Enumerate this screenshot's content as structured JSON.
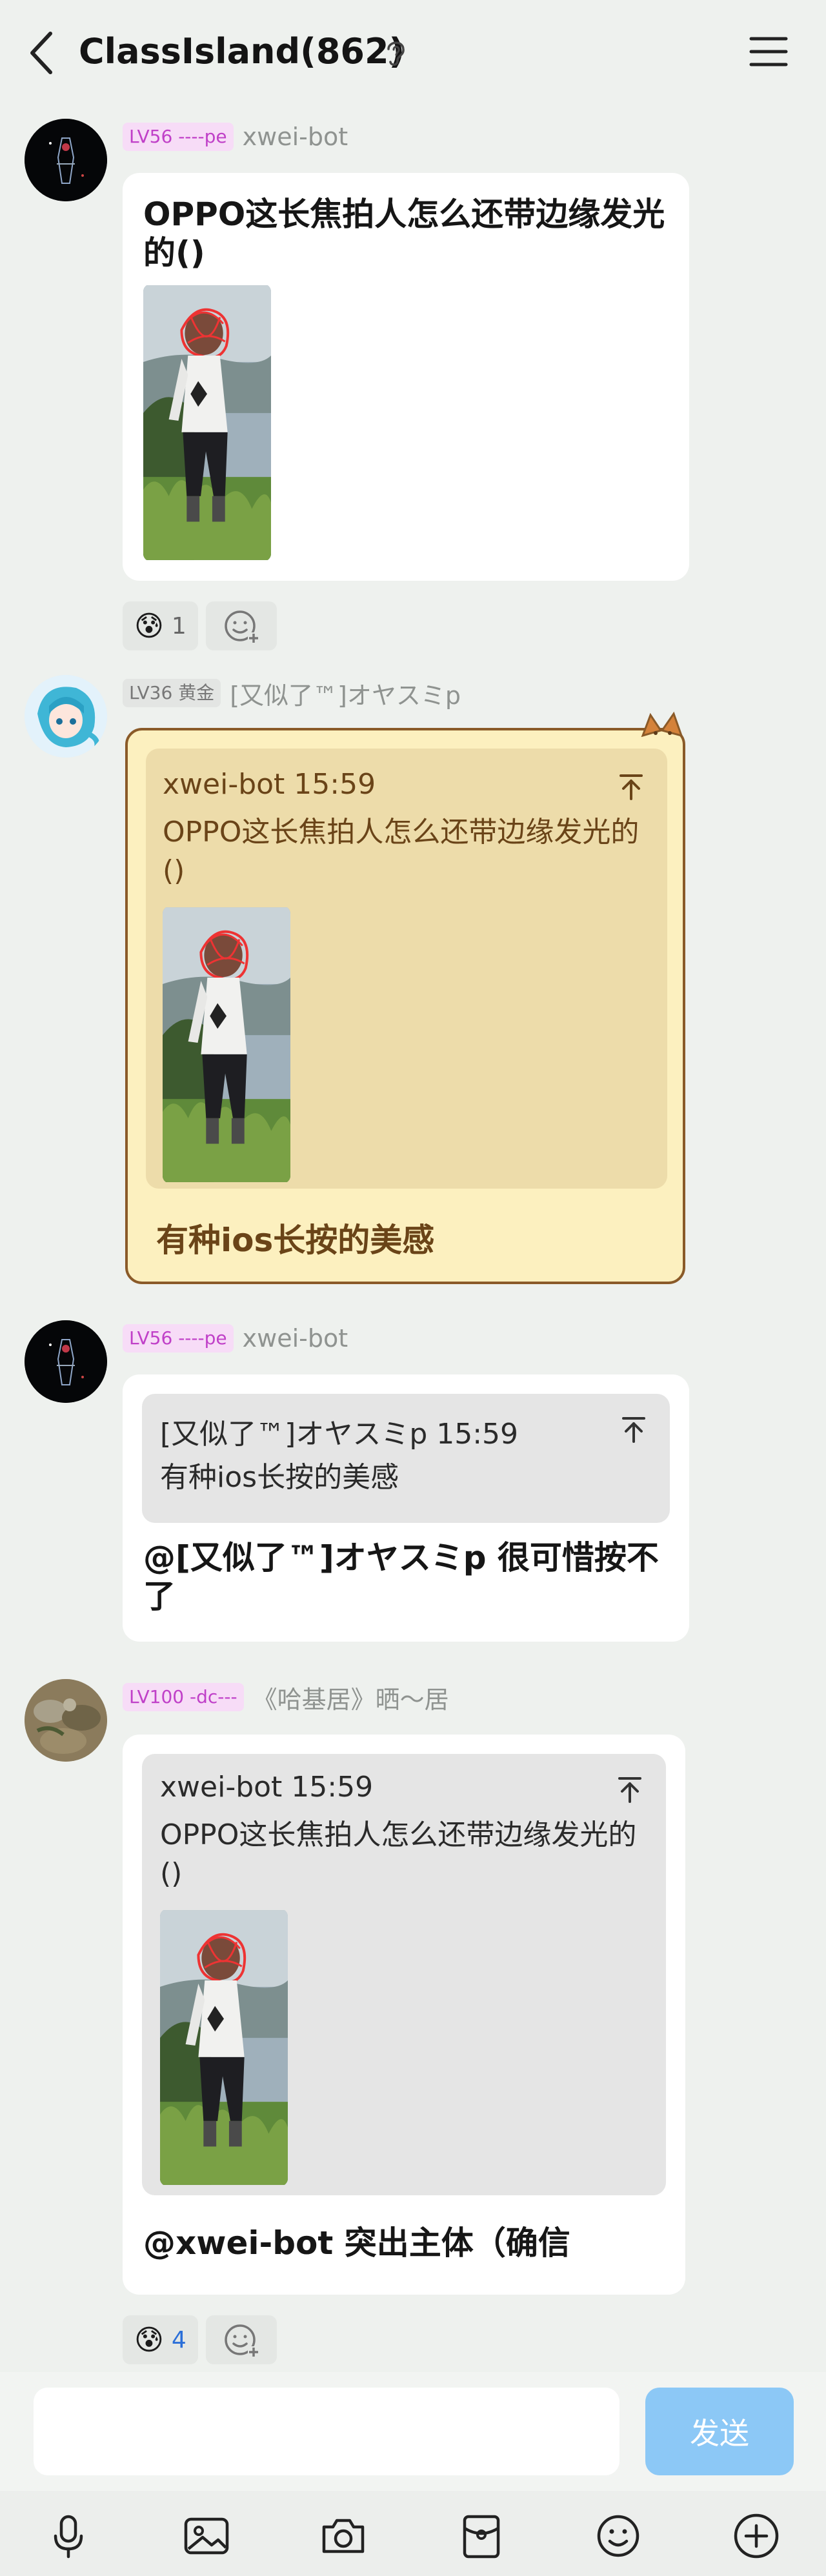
{
  "header": {
    "title": "ClassIsland(862)",
    "icons": {
      "back": "chevron-left-icon",
      "ear": "ear-icon",
      "menu": "hamburger-menu-icon"
    }
  },
  "messages": [
    {
      "badge": "LV56 ----pe",
      "nick": "xwei-bot",
      "text": "OPPO这长焦拍人怎么还带边缘发光的()",
      "has_photo": true
    },
    {
      "badge": "LV36 黄金",
      "nick": "[又似了™]オヤスミp",
      "quote": {
        "header": "xwei-bot 15:59",
        "body": "OPPO这长焦拍人怎么还带边缘发光的()"
      },
      "text": "有种ios长按的美感"
    },
    {
      "badge": "LV56 ----pe",
      "nick": "xwei-bot",
      "quote": {
        "header": "[又似了™]オヤスミp 15:59",
        "body": "有种ios长按的美感"
      },
      "text": "@[又似了™]オヤスミp 很可惜按不了"
    },
    {
      "badge": "LV100 -dc---",
      "nick": "《哈基居》晒～居",
      "quote": {
        "header": "xwei-bot 15:59",
        "body": "OPPO这长焦拍人怎么还带边缘发光的()"
      },
      "text": "@xwei-bot 突出主体（确信"
    }
  ],
  "reactions": [
    {
      "emoji": "😰",
      "count": "1"
    },
    {
      "emoji": "😰",
      "count": "4"
    }
  ],
  "composer": {
    "placeholder": "",
    "send_label": "发送"
  },
  "toolbar": [
    "microphone-icon",
    "image-icon",
    "camera-icon",
    "red-packet-icon",
    "emoji-icon",
    "plus-icon"
  ],
  "colors": {
    "background": "#eef1ee",
    "bubble": "#ffffff",
    "beige_bubble": "#fbefbf",
    "send_button": "#8cc8f6",
    "badge_pink": "#f7dcf7"
  }
}
